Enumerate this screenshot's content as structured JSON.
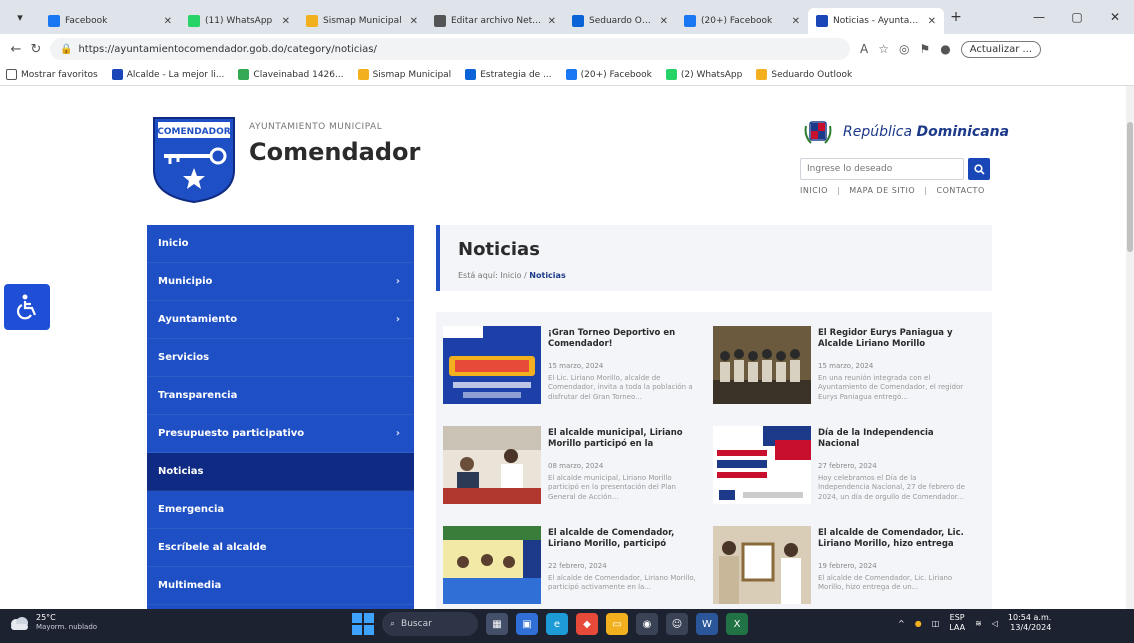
{
  "browser": {
    "tabs": [
      {
        "title": "Facebook",
        "favicon_color": "#1877f2",
        "active": false
      },
      {
        "title": "(11) WhatsApp",
        "favicon_color": "#25d366",
        "active": false
      },
      {
        "title": "Sismap Municipal",
        "favicon_color": "#f2b01e",
        "active": false
      },
      {
        "title": "Editar archivo Netdir",
        "favicon_color": "#555555",
        "active": false
      },
      {
        "title": "Seduardo Outlook",
        "favicon_color": "#0a64d8",
        "active": false
      },
      {
        "title": "(20+) Facebook",
        "favicon_color": "#1877f2",
        "active": false
      },
      {
        "title": "Noticias - Ayuntamiento",
        "favicon_color": "#1a47b8",
        "active": true
      }
    ],
    "url": "https://ayuntamientocomendador.gob.do/category/noticias/",
    "update_label": "Actualizar ...",
    "favorites_label": "Mostrar favoritos",
    "favorites": [
      {
        "label": "Alcalde - La mejor li...",
        "color": "#1a47b8"
      },
      {
        "label": "Claveinabad 1426...",
        "color": "#34a853"
      },
      {
        "label": "Sismap Municipal",
        "color": "#f2b01e"
      },
      {
        "label": "Estrategia de ...",
        "color": "#0a64d8"
      },
      {
        "label": "(20+) Facebook",
        "color": "#1877f2"
      },
      {
        "label": "(2) WhatsApp",
        "color": "#25d366"
      },
      {
        "label": "Seduardo Outlook",
        "color": "#f2b01e"
      }
    ]
  },
  "site": {
    "logo_text": "COMENDADOR",
    "subtitle": "AYUNTAMIENTO MUNICIPAL",
    "title": "Comendador",
    "gov_name_part1": "República",
    "gov_name_part2": "Dominicana",
    "search_placeholder": "Ingrese lo deseado",
    "top_links": [
      "INICIO",
      "MAPA DE SITIO",
      "CONTACTO"
    ]
  },
  "sidebar": {
    "items": [
      {
        "label": "Inicio",
        "has_sub": false,
        "active": false
      },
      {
        "label": "Municipio",
        "has_sub": true,
        "active": false
      },
      {
        "label": "Ayuntamiento",
        "has_sub": true,
        "active": false
      },
      {
        "label": "Servicios",
        "has_sub": false,
        "active": false
      },
      {
        "label": "Transparencia",
        "has_sub": false,
        "active": false
      },
      {
        "label": "Presupuesto participativo",
        "has_sub": true,
        "active": false
      },
      {
        "label": "Noticias",
        "has_sub": false,
        "active": true
      },
      {
        "label": "Emergencia",
        "has_sub": false,
        "active": false
      },
      {
        "label": "Escríbele al alcalde",
        "has_sub": false,
        "active": false
      },
      {
        "label": "Multimedia",
        "has_sub": false,
        "active": false
      }
    ]
  },
  "content": {
    "heading": "Noticias",
    "breadcrumb_prefix": "Está aquí:",
    "breadcrumb_home": "Inicio",
    "breadcrumb_sep": "/",
    "breadcrumb_current": "Noticias",
    "news": [
      {
        "title": "¡Gran Torneo Deportivo en Comendador!",
        "date": "15 marzo, 2024",
        "excerpt": "El Lic. Liriano Morillo, alcalde de Comendador, invita a toda la población a disfrutar del Gran Torneo...",
        "thumb": "poster-blue"
      },
      {
        "title": "El Regidor Eurys Paniagua y Alcalde Liriano Morillo",
        "date": "15 marzo, 2024",
        "excerpt": "En una reunión integrada con el Ayuntamiento de Comendador, el regidor Eurys Paniagua entregó...",
        "thumb": "group-photo"
      },
      {
        "title": "El alcalde municipal, Liriano Morillo participó en la",
        "date": "08 marzo, 2024",
        "excerpt": "El alcalde municipal, Liriano Morillo participó en la presentación del Plan General de Acción...",
        "thumb": "meeting"
      },
      {
        "title": "Día de la Independencia Nacional",
        "date": "27 febrero, 2024",
        "excerpt": "Hoy celebramos el Día de la Independencia Nacional, 27 de febrero de 2024, un día de orgullo de Comendador...",
        "thumb": "flag"
      },
      {
        "title": "El alcalde de Comendador, Liriano Morillo, participó",
        "date": "22 febrero, 2024",
        "excerpt": "El alcalde de Comendador, Liriano Morillo, participó activamente en la...",
        "thumb": "event"
      },
      {
        "title": "El alcalde de Comendador, Lic. Liriano Morillo, hizo entrega",
        "date": "19 febrero, 2024",
        "excerpt": "El alcalde de Comendador, Lic. Liriano Morillo, hizo entrega de un...",
        "thumb": "award"
      }
    ]
  },
  "taskbar": {
    "temperature": "25°C",
    "weather": "Mayorm. nublado",
    "search_label": "Buscar",
    "lang_top": "ESP",
    "lang_bottom": "LAA",
    "time": "10:54 a.m.",
    "date": "13/4/2024"
  },
  "colors": {
    "primary": "#1f4fc4",
    "primary_dark": "#0e2a82",
    "panel": "#f3f5f8"
  }
}
